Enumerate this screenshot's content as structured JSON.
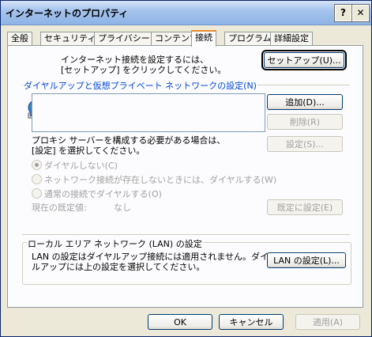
{
  "window": {
    "title": "インターネットのプロパティ",
    "help_glyph": "?",
    "close_glyph": "✕"
  },
  "tabs": [
    {
      "label": "全般"
    },
    {
      "label": "セキュリティ"
    },
    {
      "label": "プライバシー"
    },
    {
      "label": "コンテンツ"
    },
    {
      "label": "接続"
    },
    {
      "label": "プログラム"
    },
    {
      "label": "詳細設定"
    }
  ],
  "connection": {
    "intro_line1": "インターネット接続を設定するには、",
    "intro_line2": "[セットアップ] をクリックしてください。",
    "setup_button": "セットアップ(U)..."
  },
  "dialup": {
    "title": "ダイヤルアップと仮想プライベート ネットワークの設定(N)",
    "add_button": "追加(D)...",
    "remove_button": "削除(R)",
    "settings_button": "設定(S)...",
    "proxy_line1": "プロキシ サーバーを構成する必要がある場合は、",
    "proxy_line2": "[設定] を選択してください。",
    "radio_never": "ダイヤルしない(C)",
    "radio_when_no_network": "ネットワーク接続が存在しないときには、ダイヤルする(W)",
    "radio_always": "通常の接続でダイヤルする(O)",
    "current_default_label": "現在の既定値:",
    "current_default_value": "なし",
    "set_default_button": "既定に設定(E)"
  },
  "lan": {
    "title": "ローカル エリア ネットワーク (LAN) の設定",
    "text_line1": "LAN の設定はダイヤルアップ接続には適用されません。ダイヤ",
    "text_line2": "ルアップには上の設定を選択してください。",
    "settings_button": "LAN の設定(L)..."
  },
  "footer": {
    "ok_button": "OK",
    "cancel_button": "キャンセル",
    "apply_button": "適用(A)"
  },
  "colors": {
    "accent": "#0046d5",
    "tab_highlight": "#e68b2c",
    "background": "#ece9d8"
  }
}
